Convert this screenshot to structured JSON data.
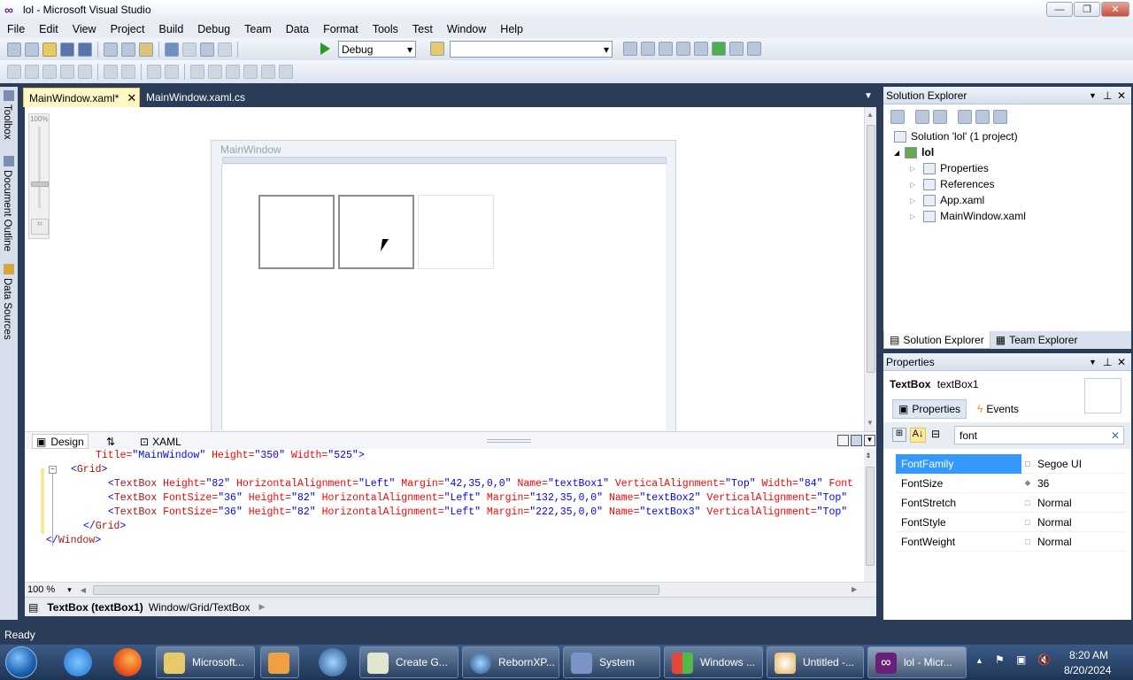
{
  "window": {
    "title": "lol - Microsoft Visual Studio"
  },
  "menu": [
    "File",
    "Edit",
    "View",
    "Project",
    "Build",
    "Debug",
    "Team",
    "Data",
    "Format",
    "Tools",
    "Test",
    "Window",
    "Help"
  ],
  "toolbar": {
    "config": "Debug",
    "platform": ""
  },
  "left_tabs": [
    "Toolbox",
    "Document Outline",
    "Data Sources"
  ],
  "doc_tabs": [
    {
      "label": "MainWindow.xaml*",
      "active": true
    },
    {
      "label": "MainWindow.xaml.cs",
      "active": false
    }
  ],
  "designer": {
    "zoom": "100%",
    "window_title": "MainWindow"
  },
  "split_tabs": {
    "design": "Design",
    "swap": "⇅",
    "xaml": "XAML"
  },
  "xaml_lines": [
    {
      "indent": 5,
      "parts": [
        [
          "attr",
          "Title="
        ],
        [
          "val",
          "\"MainWindow\""
        ],
        [
          "attr",
          " Height="
        ],
        [
          "val",
          "\"350\""
        ],
        [
          "attr",
          " Width="
        ],
        [
          "val",
          "\"525\""
        ],
        [
          "brk",
          ">"
        ]
      ]
    },
    {
      "indent": 3,
      "parts": [
        [
          "brk",
          "<"
        ],
        [
          "tag",
          "Grid"
        ],
        [
          "brk",
          ">"
        ]
      ]
    },
    {
      "indent": 6,
      "parts": [
        [
          "brk",
          "<"
        ],
        [
          "tag",
          "TextBox"
        ],
        [
          "attr",
          " Height="
        ],
        [
          "val",
          "\"82\""
        ],
        [
          "attr",
          " HorizontalAlignment="
        ],
        [
          "val",
          "\"Left\""
        ],
        [
          "attr",
          " Margin="
        ],
        [
          "val",
          "\"42,35,0,0\""
        ],
        [
          "attr",
          " Name="
        ],
        [
          "val",
          "\"textBox1\""
        ],
        [
          "attr",
          " VerticalAlignment="
        ],
        [
          "val",
          "\"Top\""
        ],
        [
          "attr",
          " Width="
        ],
        [
          "val",
          "\"84\""
        ],
        [
          "attr",
          " Font"
        ]
      ]
    },
    {
      "indent": 6,
      "parts": [
        [
          "brk",
          "<"
        ],
        [
          "tag",
          "TextBox"
        ],
        [
          "attr",
          " FontSize="
        ],
        [
          "val",
          "\"36\""
        ],
        [
          "attr",
          " Height="
        ],
        [
          "val",
          "\"82\""
        ],
        [
          "attr",
          " HorizontalAlignment="
        ],
        [
          "val",
          "\"Left\""
        ],
        [
          "attr",
          " Margin="
        ],
        [
          "val",
          "\"132,35,0,0\""
        ],
        [
          "attr",
          " Name="
        ],
        [
          "val",
          "\"textBox2\""
        ],
        [
          "attr",
          " VerticalAlignment="
        ],
        [
          "val",
          "\"Top\""
        ]
      ]
    },
    {
      "indent": 6,
      "parts": [
        [
          "brk",
          "<"
        ],
        [
          "tag",
          "TextBox"
        ],
        [
          "attr",
          " FontSize="
        ],
        [
          "val",
          "\"36\""
        ],
        [
          "attr",
          " Height="
        ],
        [
          "val",
          "\"82\""
        ],
        [
          "attr",
          " HorizontalAlignment="
        ],
        [
          "val",
          "\"Left\""
        ],
        [
          "attr",
          " Margin="
        ],
        [
          "val",
          "\"222,35,0,0\""
        ],
        [
          "attr",
          " Name="
        ],
        [
          "val",
          "\"textBox3\""
        ],
        [
          "attr",
          " VerticalAlignment="
        ],
        [
          "val",
          "\"Top\""
        ]
      ]
    },
    {
      "indent": 4,
      "parts": [
        [
          "brk",
          "</"
        ],
        [
          "tag",
          "Grid"
        ],
        [
          "brk",
          ">"
        ]
      ]
    },
    {
      "indent": 1,
      "parts": [
        [
          "brk",
          "</"
        ],
        [
          "tag",
          "Window"
        ],
        [
          "brk",
          ">"
        ]
      ]
    }
  ],
  "editor_zoom": "100 %",
  "breadcrumb": {
    "element": "TextBox (textBox1)",
    "path": "Window/Grid/TextBox"
  },
  "solution_explorer": {
    "title": "Solution Explorer",
    "solution": "Solution 'lol' (1 project)",
    "project": "lol",
    "items": [
      "Properties",
      "References",
      "App.xaml",
      "MainWindow.xaml"
    ],
    "tab_solution": "Solution Explorer",
    "tab_team": "Team Explorer"
  },
  "properties": {
    "title": "Properties",
    "type": "TextBox",
    "name": "textBox1",
    "tab_props": "Properties",
    "tab_events": "Events",
    "search": "font",
    "rows": [
      {
        "name": "FontFamily",
        "value": "Segoe UI",
        "selected": true
      },
      {
        "name": "FontSize",
        "value": "36",
        "selected": false
      },
      {
        "name": "FontStretch",
        "value": "Normal",
        "selected": false
      },
      {
        "name": "FontStyle",
        "value": "Normal",
        "selected": false
      },
      {
        "name": "FontWeight",
        "value": "Normal",
        "selected": false
      }
    ]
  },
  "status": "Ready",
  "taskbar": {
    "tasks": [
      "Microsoft...",
      "",
      "Create G...",
      "RebornXP...",
      "System",
      "Windows ...",
      "Untitled -...",
      "lol - Micr..."
    ],
    "time": "8:20 AM",
    "date": "8/20/2024"
  },
  "colors": {
    "accent": "#3399ff",
    "chrome": "#2b3c59",
    "active_tab": "#fff7c4"
  }
}
